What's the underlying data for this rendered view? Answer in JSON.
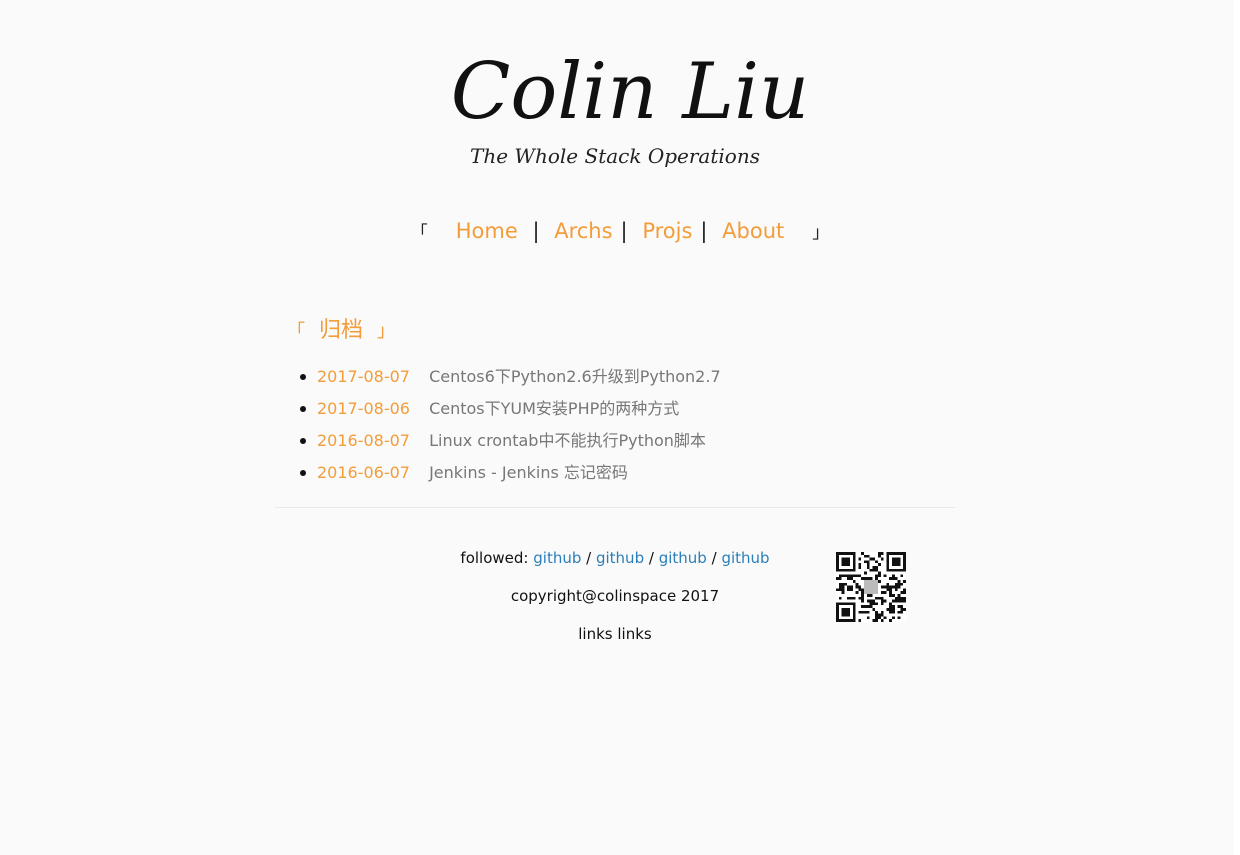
{
  "site": {
    "logo_title": "Colin Liu",
    "logo_subtitle": "The Whole Stack Operations"
  },
  "nav": {
    "open_bracket": "「",
    "close_bracket": "」",
    "separator": "|",
    "items": [
      {
        "label": "Home"
      },
      {
        "label": "Archs"
      },
      {
        "label": "Projs"
      },
      {
        "label": "About"
      }
    ]
  },
  "archive": {
    "open_bracket": "「",
    "heading": "归档",
    "close_bracket": "」",
    "posts": [
      {
        "date": "2017-08-07",
        "title": "Centos6下Python2.6升级到Python2.7"
      },
      {
        "date": "2017-08-06",
        "title": "Centos下YUM安装PHP的两种方式"
      },
      {
        "date": "2016-08-07",
        "title": "Linux crontab中不能执行Python脚本"
      },
      {
        "date": "2016-06-07",
        "title": "Jenkins - Jenkins 忘记密码"
      }
    ]
  },
  "footer": {
    "followed_label": "followed:",
    "link_separator": "/",
    "links": [
      {
        "label": "github"
      },
      {
        "label": "github"
      },
      {
        "label": "github"
      },
      {
        "label": "github"
      }
    ],
    "copyright": "copyright@colinspace 2017",
    "links_text": "links links"
  },
  "colors": {
    "accent": "#f39c3a",
    "link": "#2b7fb8",
    "muted": "#777777",
    "background": "#fafafa"
  }
}
